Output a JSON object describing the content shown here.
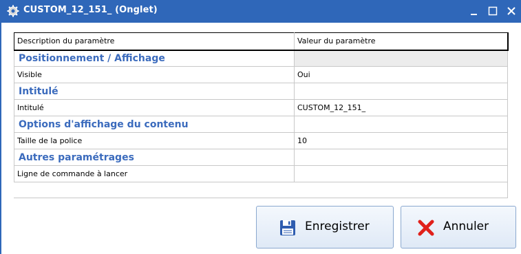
{
  "window": {
    "title": "CUSTOM_12_151_ (Onglet)",
    "title_icon": "gear-icon",
    "controls": {
      "minimize": "minimize-icon",
      "maximize": "maximize-icon",
      "close": "close-icon"
    }
  },
  "grid": {
    "headers": {
      "description": "Description du paramètre",
      "value": "Valeur du paramètre"
    },
    "sections": [
      {
        "title": "Positionnement / Affichage",
        "rows": [
          {
            "label": "Visible",
            "value": "Oui"
          }
        ]
      },
      {
        "title": "Intitulé",
        "rows": [
          {
            "label": "Intitulé",
            "value": "CUSTOM_12_151_"
          }
        ]
      },
      {
        "title": "Options d'affichage du contenu",
        "rows": [
          {
            "label": "Taille de la police",
            "value": "10"
          }
        ]
      },
      {
        "title": "Autres paramétrages",
        "rows": [
          {
            "label": "Ligne de commande à lancer",
            "value": ""
          }
        ]
      }
    ]
  },
  "buttons": {
    "save": {
      "label": "Enregistrer",
      "icon": "floppy-disk-icon"
    },
    "cancel": {
      "label": "Annuler",
      "icon": "red-x-icon"
    }
  },
  "colors": {
    "titlebar": "#2f67b9",
    "section_title": "#3b6bbd",
    "cancel_icon": "#e0201b",
    "save_icon": "#2f5db0"
  }
}
